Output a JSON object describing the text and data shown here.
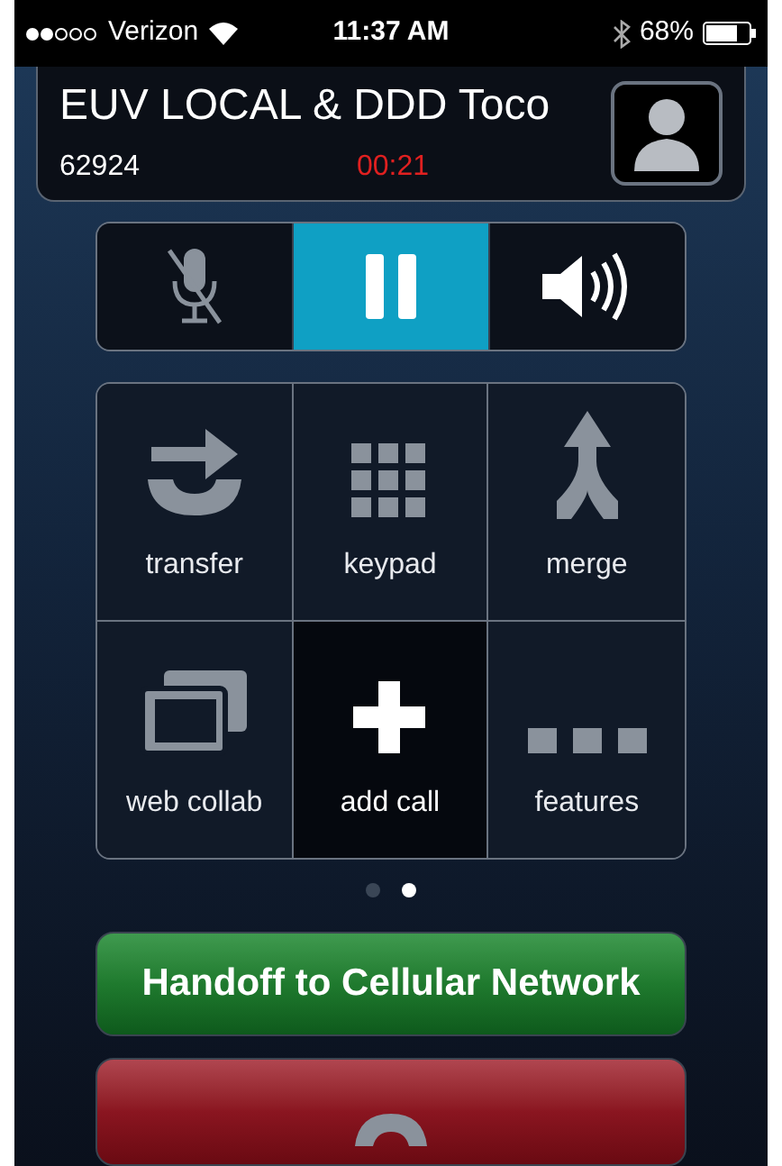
{
  "status_bar": {
    "carrier": "Verizon",
    "time": "11:37 AM",
    "battery": "68%"
  },
  "call": {
    "name": "EUV LOCAL & DDD Toco",
    "number": "62924",
    "duration": "00:21"
  },
  "controls": [
    {
      "kind": "mute",
      "selected": false,
      "on": false
    },
    {
      "kind": "hold",
      "selected": true,
      "on": true
    },
    {
      "kind": "speaker",
      "selected": false,
      "on": true
    }
  ],
  "actions": [
    {
      "kind": "transfer",
      "label": "transfer",
      "selected": false
    },
    {
      "kind": "keypad",
      "label": "keypad",
      "selected": false
    },
    {
      "kind": "merge",
      "label": "merge",
      "selected": false
    },
    {
      "kind": "web_collab",
      "label": "web collab",
      "selected": false
    },
    {
      "kind": "add_call",
      "label": "add call",
      "selected": true
    },
    {
      "kind": "features",
      "label": "features",
      "selected": false
    }
  ],
  "pages": [
    {
      "selected": false
    },
    {
      "selected": true
    }
  ],
  "handoff_button": "Handoff to Cellular Network"
}
